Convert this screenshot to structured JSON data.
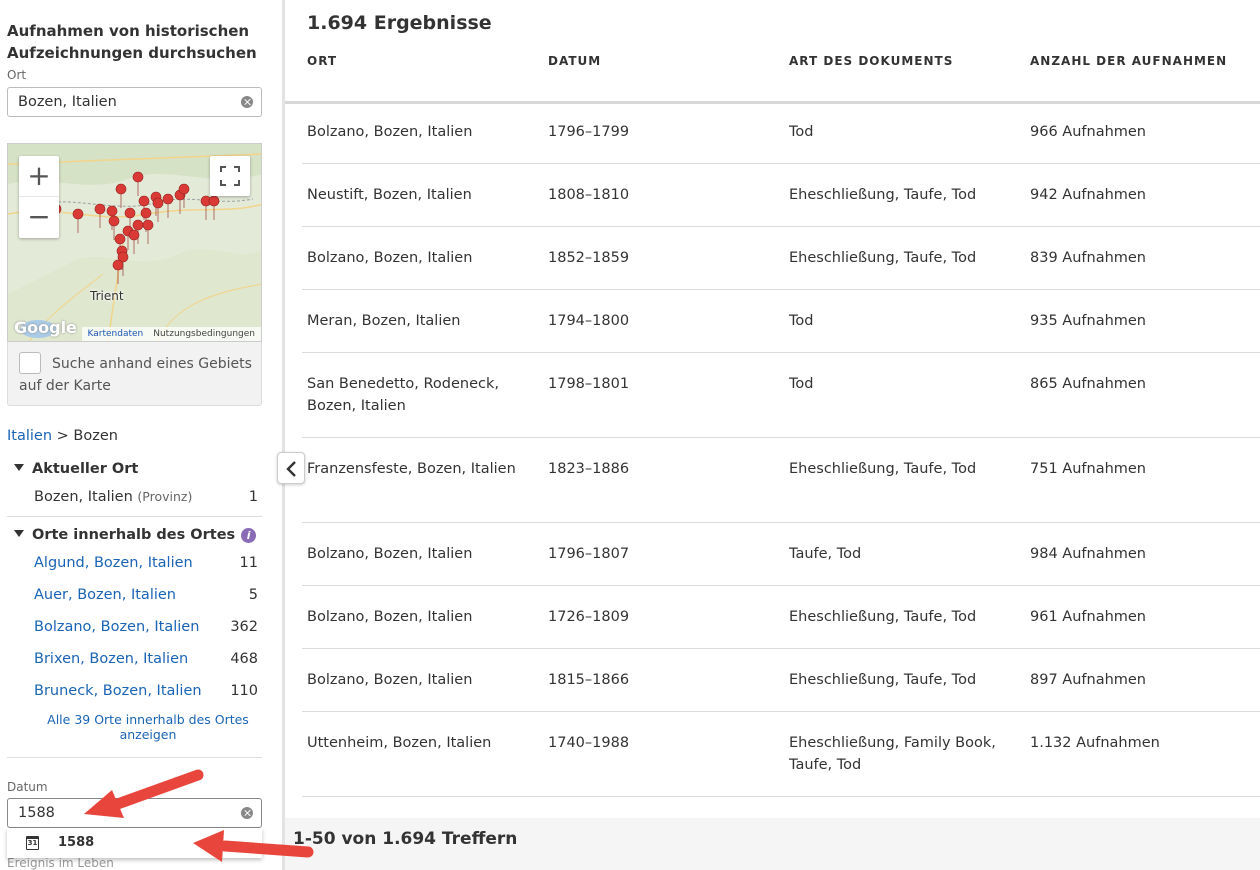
{
  "sidebar": {
    "title": "Aufnahmen von historischen Aufzeichnungen durchsuchen",
    "place_label": "Ort",
    "place_value": "Bozen, Italien",
    "map": {
      "city_label": "Trient",
      "google": "Google",
      "map_data": "Kartendaten",
      "terms": "Nutzungsbedingungen",
      "zoom_in": "+",
      "zoom_out": "−"
    },
    "area_search_label": "Suche anhand eines Gebiets auf der Karte",
    "breadcrumb": {
      "parent": "Italien",
      "separator": ">",
      "current": "Bozen"
    },
    "current_place": {
      "heading": "Aktueller Ort",
      "name": "Bozen, Italien",
      "type": "(Provinz)",
      "count": "1"
    },
    "places_within": {
      "heading": "Orte innerhalb des Ortes",
      "items": [
        {
          "name": "Algund, Bozen, Italien",
          "count": "11"
        },
        {
          "name": "Auer, Bozen, Italien",
          "count": "5"
        },
        {
          "name": "Bolzano, Bozen, Italien",
          "count": "362"
        },
        {
          "name": "Brixen, Bozen, Italien",
          "count": "468"
        },
        {
          "name": "Bruneck, Bozen, Italien",
          "count": "110"
        }
      ],
      "show_all": "Alle 39 Orte innerhalb des Ortes anzeigen"
    },
    "date_label": "Datum",
    "date_value": "1588",
    "date_suggestion": "1588",
    "calendar_icon_text": "31",
    "life_event_label": "Ereignis im Leben"
  },
  "main": {
    "results_title": "1.694 Ergebnisse",
    "columns": [
      "ORT",
      "DATUM",
      "ART DES DOKUMENTS",
      "ANZAHL DER AUFNAHMEN"
    ],
    "rows": [
      {
        "ort": "Bolzano, Bozen, Italien",
        "datum": "1796–1799",
        "art": "Tod",
        "anzahl": "966 Aufnahmen"
      },
      {
        "ort": "Neustift, Bozen, Italien",
        "datum": "1808–1810",
        "art": "Eheschließung, Taufe, Tod",
        "anzahl": "942 Aufnahmen"
      },
      {
        "ort": "Bolzano, Bozen, Italien",
        "datum": "1852–1859",
        "art": "Eheschließung, Taufe, Tod",
        "anzahl": "839 Aufnahmen"
      },
      {
        "ort": "Meran, Bozen, Italien",
        "datum": "1794–1800",
        "art": "Tod",
        "anzahl": "935 Aufnahmen"
      },
      {
        "ort": "San Benedetto, Rodeneck, Bozen, Italien",
        "datum": "1798–1801",
        "art": "Tod",
        "anzahl": "865 Aufnahmen"
      },
      {
        "ort": "Franzensfeste, Bozen, Italien",
        "datum": "1823–1886",
        "art": "Eheschließung, Taufe, Tod",
        "anzahl": "751 Aufnahmen"
      },
      {
        "ort": "Bolzano, Bozen, Italien",
        "datum": "1796–1807",
        "art": "Taufe, Tod",
        "anzahl": "984 Aufnahmen"
      },
      {
        "ort": "Bolzano, Bozen, Italien",
        "datum": "1726–1809",
        "art": "Eheschließung, Taufe, Tod",
        "anzahl": "961 Aufnahmen"
      },
      {
        "ort": "Bolzano, Bozen, Italien",
        "datum": "1815–1866",
        "art": "Eheschließung, Taufe, Tod",
        "anzahl": "897 Aufnahmen"
      },
      {
        "ort": "Uttenheim, Bozen, Italien",
        "datum": "1740–1988",
        "art": "Eheschließung, Family Book, Taufe, Tod",
        "anzahl": "1.132 Aufnahmen"
      }
    ],
    "pager_text": "1-50 von 1.694 Treffern"
  },
  "colors": {
    "link": "#1a64b5",
    "annotation_arrow": "#e8463c",
    "map_pin": "#d93a36",
    "info_icon": "#8a6bb5"
  }
}
